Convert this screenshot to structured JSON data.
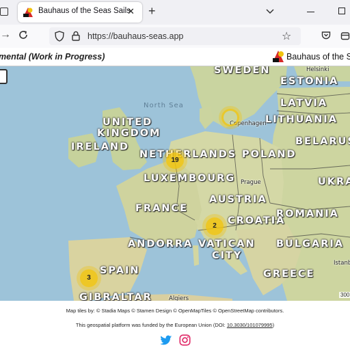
{
  "browser": {
    "tab_title": "Bauhaus of the Seas Sails",
    "tab_close": "✕",
    "new_tab": "+",
    "url": "https://bauhaus-seas.app"
  },
  "header": {
    "subtitle": "mental (Work in Progress)",
    "brand": "Bauhaus of the Se"
  },
  "map": {
    "labels": {
      "sweden": "SWEDEN",
      "estonia": "ESTONIA",
      "latvia": "LATVIA",
      "lithuania": "LITHUANIA",
      "belarus": "BELARUS",
      "north_sea": "North Sea",
      "united": "UNITED",
      "kingdom": "KINGDOM",
      "ireland": "IRELAND",
      "netherlands": "NETHERLANDS",
      "poland": "POLAND",
      "luxembourg": "LUXEMBOURG",
      "ukra": "UKRA",
      "france": "FRANCE",
      "austria": "AUSTRIA",
      "croatia": "CROATIA",
      "romania": "ROMANIA",
      "andorra": "ANDORRA",
      "vatican": "VATICAN",
      "city": "CITY",
      "bulgaria": "BULGARIA",
      "spain": "SPAIN",
      "greece": "GREECE",
      "gibraltar": "GIBRALTAR",
      "helsinki": "Helsinki",
      "copenhagen": "Copenhagen",
      "prague": "Prague",
      "istanbul": "Istanbul",
      "algiers": "Algiers"
    },
    "clusters": {
      "copenhagen": "",
      "netherlands": "19",
      "italy": "2",
      "portugal": "3"
    },
    "scale_text": "300",
    "land_color": "#cfd6a2",
    "water_color": "#9dc3d9",
    "cluster_color": "#f1c40f"
  },
  "footer": {
    "credits": "Map tiles by: © Stadia Maps © Stamen Design © OpenMapTiles © OpenStreetMap contributors.",
    "funding_prefix": "This geospatial platform was funded by the European Union (DOI: ",
    "doi": "10.3030/101079995",
    "funding_suffix": ")"
  }
}
